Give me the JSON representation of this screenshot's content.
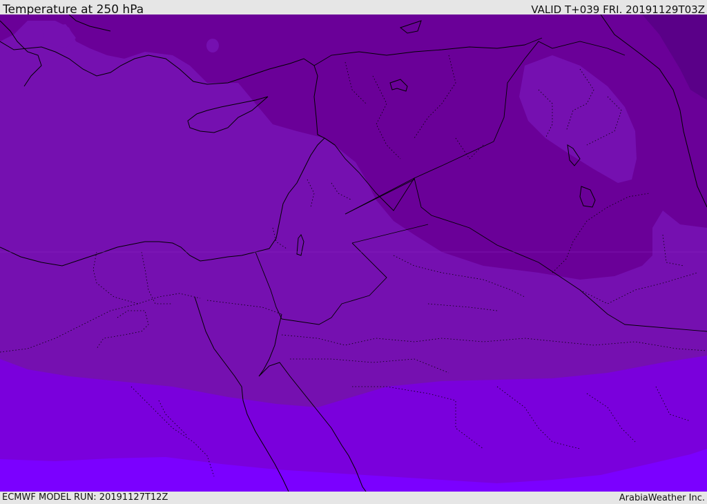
{
  "header": {
    "title": "Temperature at 250 hPa",
    "valid": "VALID T+039 FRI. 20191129T03Z"
  },
  "footer": {
    "model_run": "ECMWF MODEL RUN: 20191127T12Z",
    "credit": "ArabiaWeather Inc."
  },
  "map": {
    "colors": {
      "coldest": "#5a0088",
      "cold": "#6a0098",
      "mid": "#7510b0",
      "warm": "#7a00dc",
      "warmest": "#7b00ff",
      "border": "#000000"
    }
  }
}
